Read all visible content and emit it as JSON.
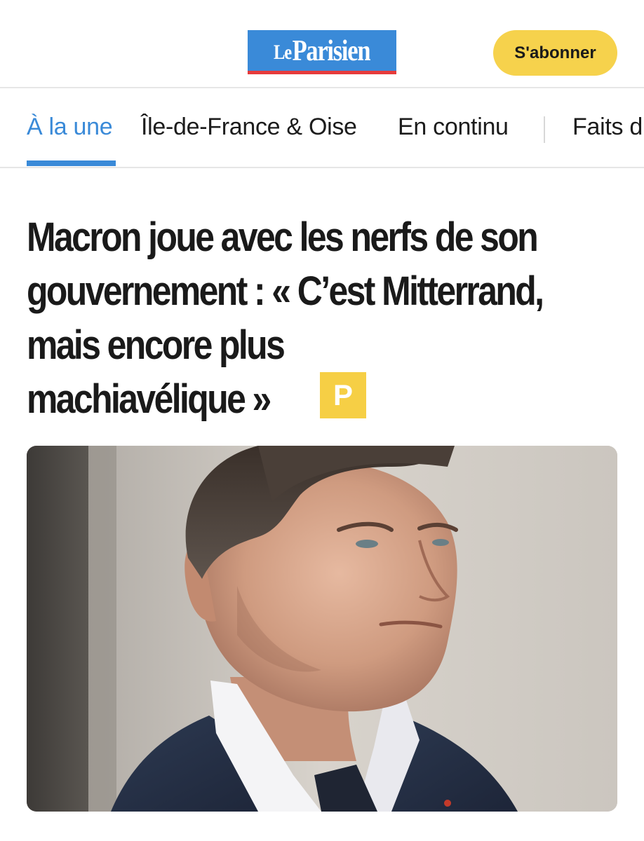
{
  "header": {
    "logo": {
      "text_le": "Le",
      "text_main": "Parisien",
      "brand_color": "#3a8ad8",
      "accent_color": "#e63b3b"
    },
    "subscribe_label": "S'abonner",
    "subscribe_color": "#f6d24c"
  },
  "nav": {
    "items": [
      {
        "label": "À la une",
        "active": true
      },
      {
        "label": "Île-de-France & Oise",
        "active": false
      },
      {
        "label": "En continu",
        "active": false
      },
      {
        "label": "Faits d",
        "active": false
      }
    ],
    "active_color": "#3a8ad8"
  },
  "article": {
    "headline_lines": [
      "Macron joue avec les nerfs de son",
      "gouvernement : « C’est Mitterrand,",
      "mais encore plus",
      "machiavélique »"
    ],
    "premium_badge": "P",
    "premium_color": "#f6cf45",
    "photo_icon": "portrait-photo"
  }
}
